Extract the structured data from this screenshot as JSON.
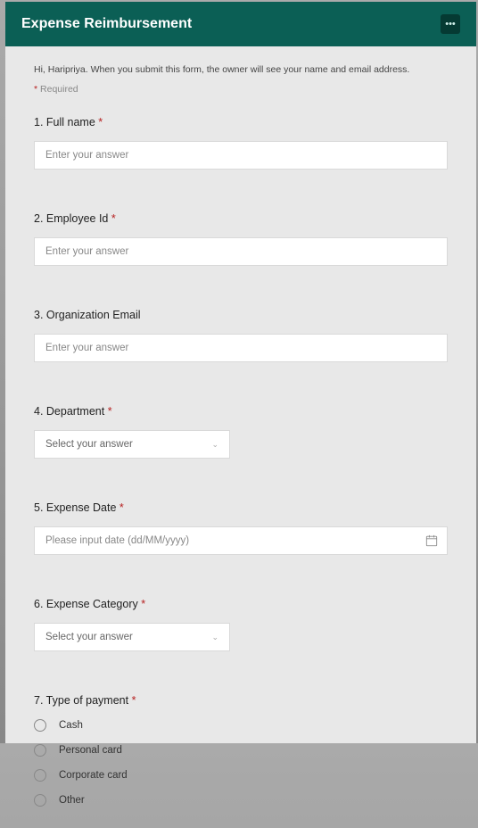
{
  "header": {
    "title": "Expense Reimbursement"
  },
  "intro": "Hi, Haripriya. When you submit this form, the owner will see your name and email address.",
  "required_note": "Required",
  "questions": {
    "q1": {
      "label": "1. Full name",
      "required": true,
      "placeholder": "Enter your answer"
    },
    "q2": {
      "label": "2. Employee Id",
      "required": true,
      "placeholder": "Enter your answer"
    },
    "q3": {
      "label": "3. Organization Email",
      "required": false,
      "placeholder": "Enter your answer"
    },
    "q4": {
      "label": "4. Department",
      "required": true,
      "placeholder": "Select your answer"
    },
    "q5": {
      "label": "5. Expense Date",
      "required": true,
      "placeholder": "Please input date (dd/MM/yyyy)"
    },
    "q6": {
      "label": "6. Expense Category",
      "required": true,
      "placeholder": "Select your answer"
    },
    "q7": {
      "label": "7. Type of payment",
      "required": true,
      "options": [
        "Cash",
        "Personal card",
        "Corporate card",
        "Other"
      ]
    }
  }
}
